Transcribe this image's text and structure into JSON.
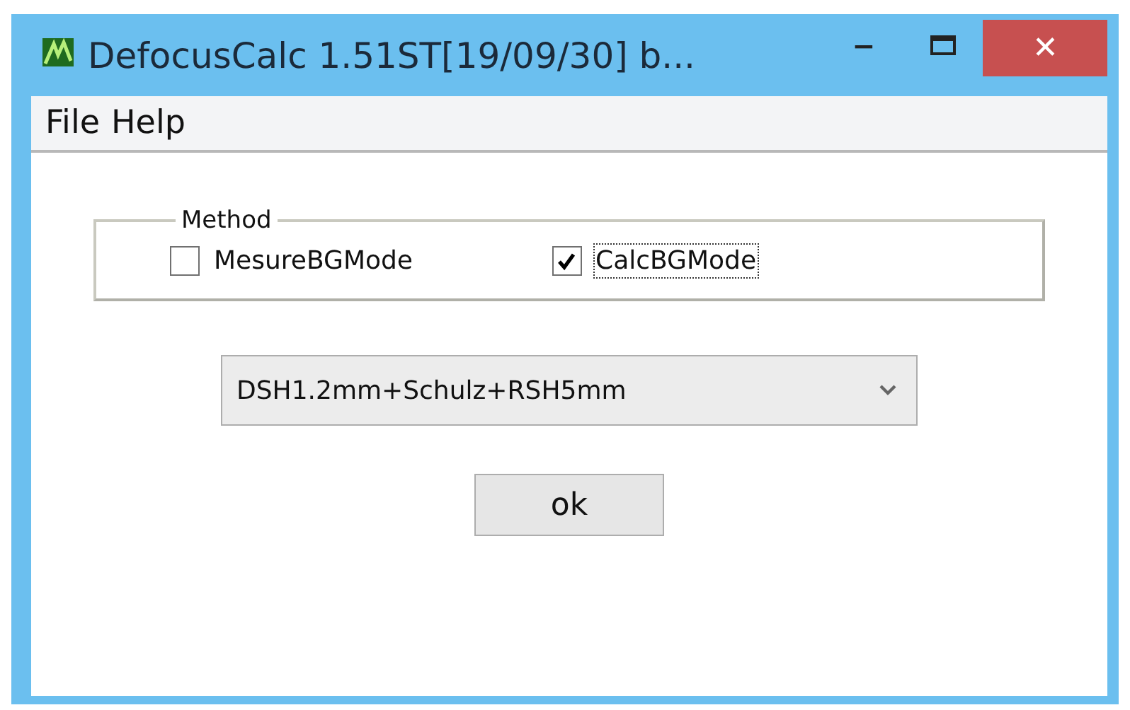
{
  "window": {
    "title": "DefocusCalc 1.51ST[19/09/30] b...",
    "minimize": "‒",
    "close": "✕"
  },
  "menu": [
    "File",
    "Help"
  ],
  "method_group": {
    "label": "Method",
    "options": [
      {
        "label": "MesureBGMode",
        "checked": false,
        "focused": false
      },
      {
        "label": "CalcBGMode",
        "checked": true,
        "focused": true
      }
    ]
  },
  "dropdown": {
    "value": "DSH1.2mm+Schulz+RSH5mm"
  },
  "buttons": [
    "ok"
  ]
}
